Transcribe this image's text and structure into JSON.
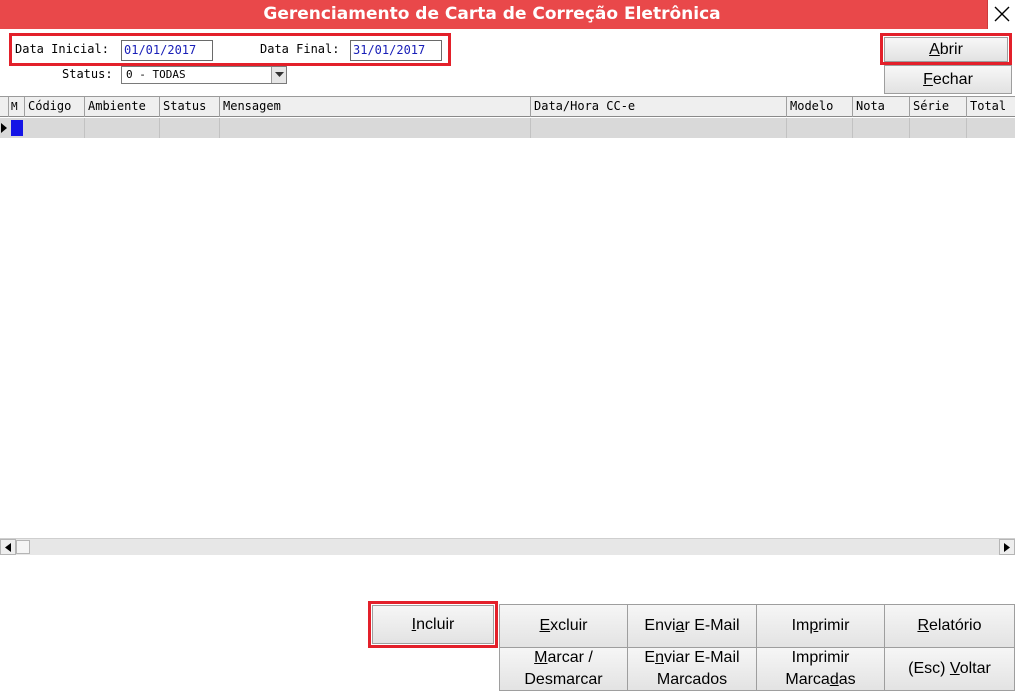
{
  "window": {
    "title": "Gerenciamento de Carta de Correção Eletrônica",
    "close_icon": "close-icon"
  },
  "filters": {
    "data_inicial_label": "Data Inicial:",
    "data_inicial_value": "01/01/2017",
    "data_final_label": "Data Final:",
    "data_final_value": "31/01/2017",
    "status_label": "Status:",
    "status_value": "0 - TODAS"
  },
  "top_buttons": {
    "abrir": {
      "pre": "",
      "key": "A",
      "post": "brir"
    },
    "fechar": {
      "pre": "",
      "key": "F",
      "post": "echar"
    }
  },
  "grid": {
    "columns": [
      "M",
      "Código",
      "Ambiente",
      "Status",
      "Mensagem",
      "Data/Hora CC-e",
      "Modelo",
      "Nota",
      "Série",
      "Total"
    ],
    "rows": [
      [
        "",
        "",
        "",
        "",
        "",
        "",
        "",
        "",
        "",
        ""
      ]
    ]
  },
  "bottom_buttons": {
    "incluir": {
      "pre": "",
      "key": "I",
      "post": "ncluir"
    },
    "excluir": {
      "pre": "",
      "key": "E",
      "post": "xcluir"
    },
    "enviar_email": {
      "pre": "Envi",
      "key": "a",
      "post": "r E-Mail"
    },
    "imprimir": {
      "pre": "Im",
      "key": "p",
      "post": "rimir"
    },
    "relatorio": {
      "pre": "",
      "key": "R",
      "post": "elatório"
    },
    "marcar_l1": {
      "pre": "",
      "key": "M",
      "post": "arcar /"
    },
    "marcar_l2": "Desmarcar",
    "enviar_marcados_l1": {
      "pre": "E",
      "key": "n",
      "post": "viar E-Mail"
    },
    "enviar_marcados_l2": "Marcados",
    "imprimir_marcadas_l1": "Imprimir",
    "imprimir_marcadas_l2": {
      "pre": "Marca",
      "key": "d",
      "post": "as"
    },
    "voltar": {
      "pre": "(Esc) ",
      "key": "V",
      "post": "oltar"
    }
  },
  "colors": {
    "title_bar": "#e9484a",
    "highlight": "#e3202a",
    "date_text": "#1a20b8",
    "mark_cell": "#1414e6"
  }
}
